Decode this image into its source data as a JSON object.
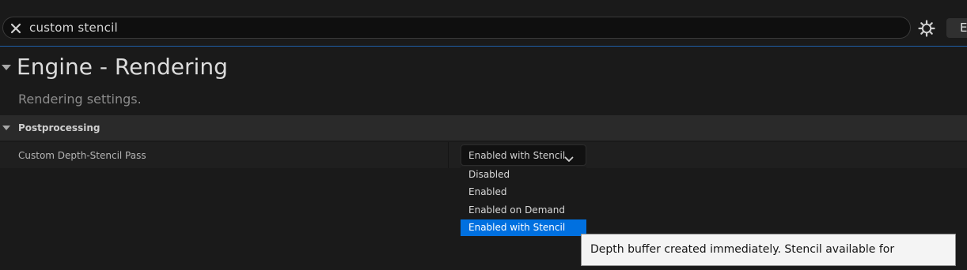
{
  "search": {
    "value": "custom stencil",
    "extra_button_label": "E"
  },
  "section": {
    "title": "Engine - Rendering",
    "description": "Rendering settings."
  },
  "category": {
    "label": "Postprocessing"
  },
  "property": {
    "label": "Custom Depth-Stencil Pass",
    "current_value": "Enabled with Stencil"
  },
  "dropdown": {
    "options": [
      "Disabled",
      "Enabled",
      "Enabled on Demand",
      "Enabled with Stencil"
    ],
    "selected": "Enabled with Stencil"
  },
  "tooltip": {
    "text": "Depth buffer created immediately. Stencil available for read/write."
  },
  "colors": {
    "accent": "#0070e0",
    "background": "#1a1a1a",
    "category_bg": "#2a2a2a"
  },
  "icons": [
    "close-icon",
    "gear-icon",
    "collapse-triangle-icon",
    "chevron-down-icon"
  ]
}
